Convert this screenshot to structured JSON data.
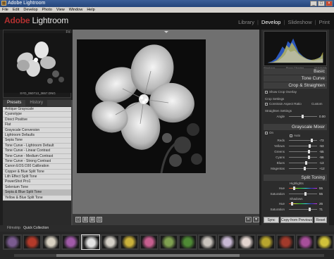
{
  "window": {
    "title": "Adobe Lightroom"
  },
  "menu": [
    "File",
    "Edit",
    "Develop",
    "Photo",
    "View",
    "Window",
    "Help"
  ],
  "logo": {
    "adobe": "Adobe",
    "product": "Lightroom"
  },
  "modules": [
    "Library",
    "Develop",
    "Slideshow",
    "Print"
  ],
  "navigator": {
    "zoom": "Fit",
    "filename": "SYD_060713_3657.DNG"
  },
  "left_tabs": [
    "Presets",
    "History"
  ],
  "presets": [
    "Antique Grayscale",
    "Cyanotype",
    "Direct Positive",
    "Flat",
    "Grayscale Conversion",
    "Lightroom Defaults",
    "Sepia Tone",
    "Tone Curve - Lightroom Default",
    "Tone Curve - Linear Contrast",
    "Tone Curve - Medium Contrast",
    "Tone Curve - Strong Contrast",
    "Canon EOS D30 Calibration",
    "Copper & Blue Split Tone",
    "Lith Effect Split Tone",
    "PowerShot Pro1",
    "Selenium Tone",
    "Sepia & Blue Split Tone",
    "Yellow & Blue Split Tone"
  ],
  "selected_preset": 16,
  "histogram": {
    "shadows": "Shadows",
    "clipping": "Show Clipping",
    "highlights": "Highlights"
  },
  "sections": {
    "basic": "Basic",
    "tone_curve": "Tone Curve",
    "crop": "Crop & Straighten",
    "grayscale": "Grayscale Mixer",
    "split_toning": "Split Toning"
  },
  "crop": {
    "show_overlay": "Show Crop Overlay",
    "crop_settings": "Crop Settings",
    "constrain": "Constrain Aspect Ratio",
    "custom": "Custom",
    "straighten": "Straighten Settings",
    "angle_label": "Angle",
    "angle_value": "0.00"
  },
  "grayscale": {
    "on": "On",
    "auto": "Auto",
    "channels": [
      {
        "label": "Reds",
        "value": "-73",
        "level": 0.78
      },
      {
        "label": "Yellows",
        "value": "-53",
        "level": 0.7
      },
      {
        "label": "Greens",
        "value": "-55",
        "level": 0.69
      },
      {
        "label": "Cyans",
        "value": "-56",
        "level": 0.69
      },
      {
        "label": "Blues",
        "value": "-13",
        "level": 0.59
      },
      {
        "label": "Magentas",
        "value": "+12",
        "level": 0.55
      }
    ]
  },
  "split_toning": {
    "highlights": "Highlights",
    "shadows": "Shadows",
    "rows": [
      {
        "label": "Hue",
        "value": "55",
        "level": 0.15
      },
      {
        "label": "Saturation",
        "value": "55",
        "level": 0.55
      },
      {
        "label": "Hue",
        "value": "26",
        "level": 0.07
      },
      {
        "label": "Saturation",
        "value": "71",
        "level": 0.71
      }
    ]
  },
  "buttons": {
    "sync": "Sync",
    "copy": "Copy from Previous",
    "reset": "Reset"
  },
  "filmstrip": {
    "label": "Filmstrip",
    "source": "Quick Collection"
  },
  "colors": {
    "accent": "#b23030",
    "panel": "#2c2c2c",
    "background": "#707070"
  },
  "thumbnails": [
    "#7a5b8f",
    "#b33a2a",
    "#d8d1c2",
    "#a05aa8",
    "#e3e3e3",
    "#d4d0c7",
    "#c9b03a",
    "#c65f8f",
    "#7fa050",
    "#4f8a35",
    "#c9c3bd",
    "#c9b9d4",
    "#e2d4cf",
    "#b8a52e",
    "#a13a2b",
    "#a74f9a",
    "#d1c23a"
  ],
  "selected_thumb": 4
}
